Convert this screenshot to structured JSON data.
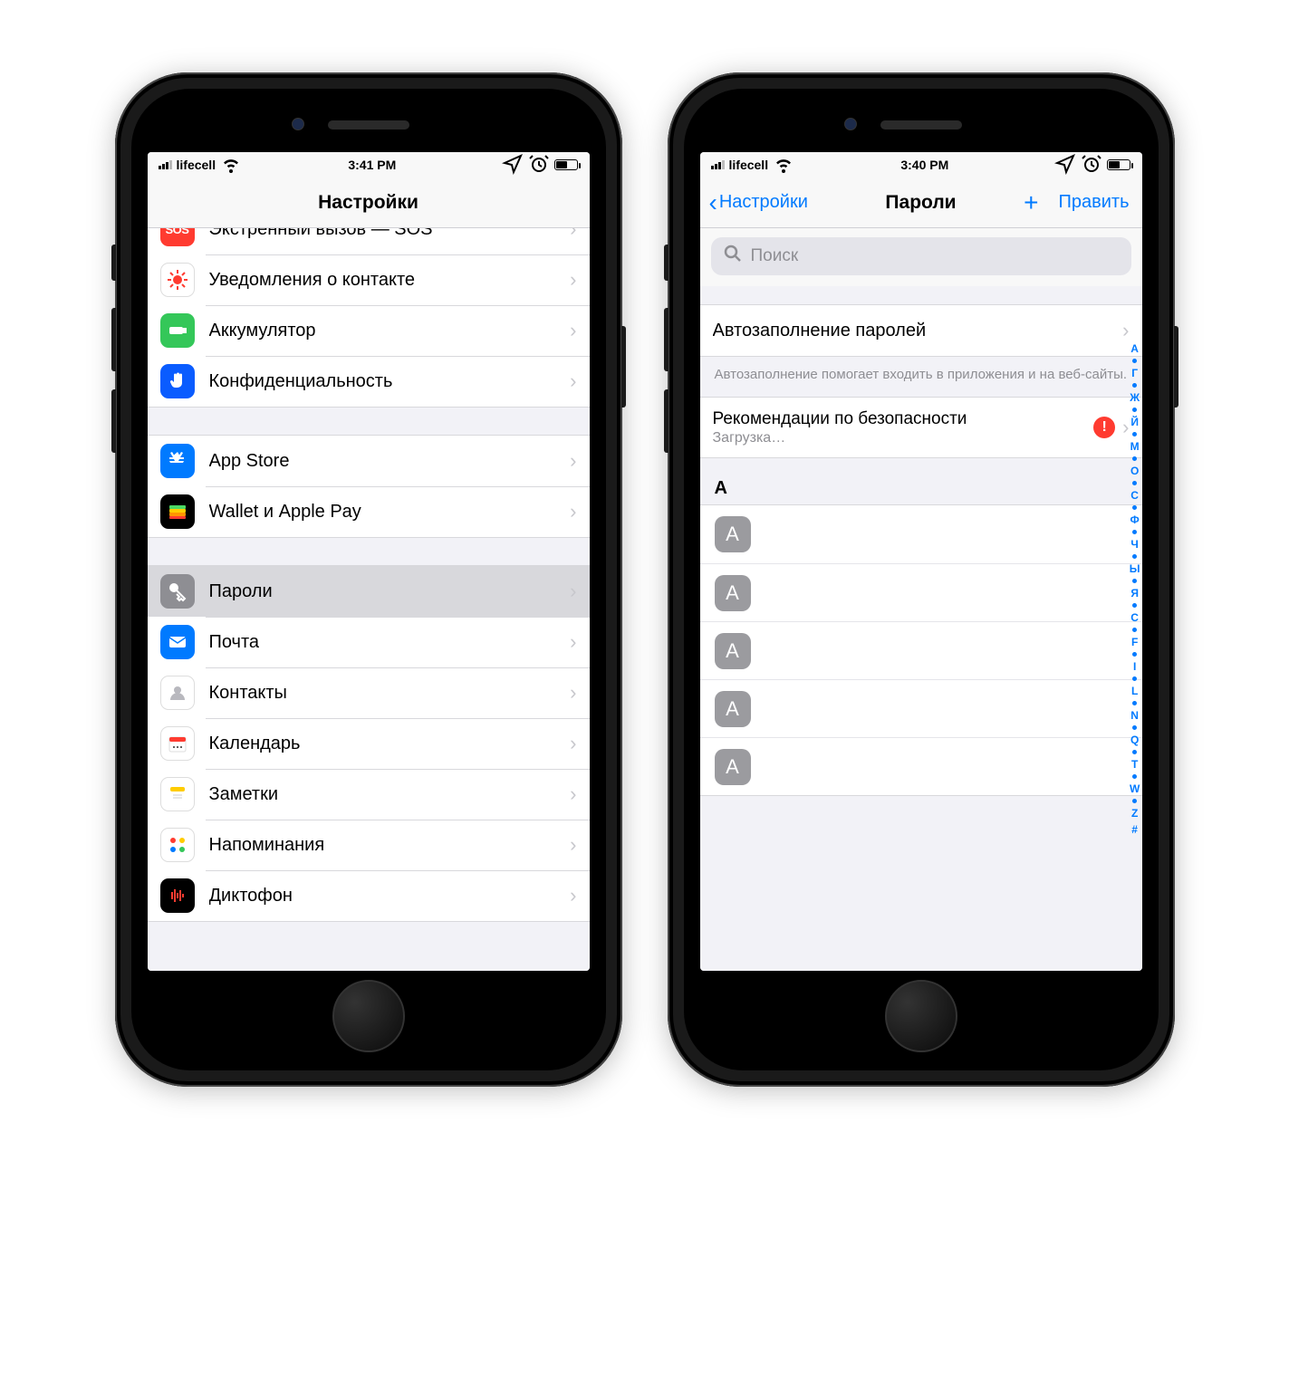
{
  "phoneLeft": {
    "status": {
      "carrier": "lifecell",
      "time": "3:41 PM"
    },
    "title": "Настройки",
    "groups": [
      [
        {
          "id": "sos",
          "label": "Экстренный вызов — SOS",
          "icon": "sos-icon",
          "color": "bg-red",
          "cut": true
        },
        {
          "id": "contact",
          "label": "Уведомления о контакте",
          "icon": "virus-icon",
          "color": "bg-white"
        },
        {
          "id": "battery",
          "label": "Аккумулятор",
          "icon": "battery-icon",
          "color": "bg-green"
        },
        {
          "id": "privacy",
          "label": "Конфиденциальность",
          "icon": "hand-icon",
          "color": "bg-hand"
        }
      ],
      [
        {
          "id": "appstore",
          "label": "App Store",
          "icon": "appstore-icon",
          "color": "bg-blue"
        },
        {
          "id": "wallet",
          "label": "Wallet и Apple Pay",
          "icon": "wallet-icon",
          "color": "bg-black"
        }
      ],
      [
        {
          "id": "passwords",
          "label": "Пароли",
          "icon": "key-icon",
          "color": "bg-gray",
          "selected": true
        },
        {
          "id": "mail",
          "label": "Почта",
          "icon": "mail-icon",
          "color": "bg-blue"
        },
        {
          "id": "contacts",
          "label": "Контакты",
          "icon": "contacts-icon",
          "color": "bg-white"
        },
        {
          "id": "calendar",
          "label": "Календарь",
          "icon": "calendar-icon",
          "color": "bg-white"
        },
        {
          "id": "notes",
          "label": "Заметки",
          "icon": "notes-icon",
          "color": "bg-white"
        },
        {
          "id": "reminders",
          "label": "Напоминания",
          "icon": "reminders-icon",
          "color": "bg-white"
        },
        {
          "id": "voice",
          "label": "Диктофон",
          "icon": "voice-icon",
          "color": "bg-black",
          "cut": true
        }
      ]
    ]
  },
  "phoneRight": {
    "status": {
      "carrier": "lifecell",
      "time": "3:40 PM"
    },
    "back": "Настройки",
    "title": "Пароли",
    "addSymbol": "+",
    "edit": "Править",
    "searchPlaceholder": "Поиск",
    "autofillLabel": "Автозаполнение паролей",
    "autofillFooter": "Автозаполнение помогает входить в приложения и на веб-сайты.",
    "securityLabel": "Рекомендации по безопасности",
    "securitySub": "Загрузка…",
    "alertBadge": "!",
    "sectionA": "A",
    "items": [
      "A",
      "A",
      "A",
      "A",
      "A"
    ],
    "index": [
      "А",
      "•",
      "Г",
      "•",
      "Ж",
      "•",
      "Й",
      "•",
      "М",
      "•",
      "О",
      "•",
      "С",
      "•",
      "Ф",
      "•",
      "Ч",
      "•",
      "Ы",
      "•",
      "Я",
      "•",
      "C",
      "•",
      "F",
      "•",
      "I",
      "•",
      "L",
      "•",
      "N",
      "•",
      "Q",
      "•",
      "T",
      "•",
      "W",
      "•",
      "Z",
      "#"
    ]
  }
}
